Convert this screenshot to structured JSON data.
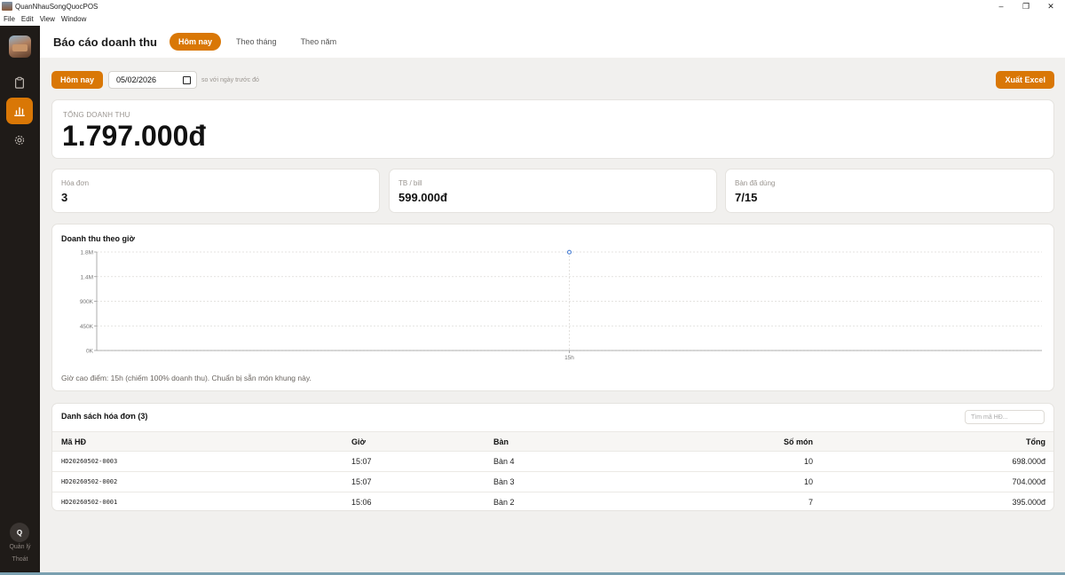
{
  "window": {
    "title": "QuanNhauSongQuocPOS",
    "minimize": "–",
    "maximize": "❐",
    "close": "✕"
  },
  "menu": [
    "File",
    "Edit",
    "View",
    "Window"
  ],
  "sidebar": {
    "user_initial": "Q",
    "user_role": "Quản lý",
    "logout": "Thoát"
  },
  "header": {
    "title": "Báo cáo doanh thu",
    "tabs": [
      "Hôm nay",
      "Theo tháng",
      "Theo năm"
    ],
    "active_tab": 0
  },
  "toolbar": {
    "today_button": "Hôm nay",
    "date_value": "05/02/2026",
    "compare_text": "so với ngày trước đó",
    "export_button": "Xuất Excel"
  },
  "total": {
    "label": "TỔNG DOANH THU",
    "value": "1.797.000đ"
  },
  "stats": [
    {
      "label": "Hóa đơn",
      "value": "3"
    },
    {
      "label": "TB / bill",
      "value": "599.000đ"
    },
    {
      "label": "Bàn đã dùng",
      "value": "7/15"
    }
  ],
  "chart_section": {
    "title": "Doanh thu theo giờ",
    "note": "Giờ cao điểm: 15h (chiếm 100% doanh thu). Chuẩn bị sẵn món khung này."
  },
  "chart_data": {
    "type": "line",
    "x": [
      "15h"
    ],
    "values": [
      1797000
    ],
    "ylim": [
      0,
      1800000
    ],
    "yticks": [
      "0K",
      "450K",
      "900K",
      "1.4M",
      "1.8M"
    ],
    "ytick_values": [
      0,
      450000,
      900000,
      1350000,
      1800000
    ],
    "grid": true,
    "color": "#4a7fd4"
  },
  "invoices": {
    "title": "Danh sách hóa đơn (3)",
    "search_placeholder": "Tìm mã HĐ...",
    "columns": [
      "Mã HĐ",
      "Giờ",
      "Bàn",
      "Số món",
      "Tổng"
    ],
    "rows": [
      [
        "HD20260502-0003",
        "15:07",
        "Bàn 4",
        "10",
        "698.000đ"
      ],
      [
        "HD20260502-0002",
        "15:07",
        "Bàn 3",
        "10",
        "704.000đ"
      ],
      [
        "HD20260502-0001",
        "15:06",
        "Bàn 2",
        "7",
        "395.000đ"
      ]
    ]
  },
  "colors": {
    "accent": "#d97706",
    "sidebar": "#1f1b18",
    "background": "#f1f0ee"
  }
}
